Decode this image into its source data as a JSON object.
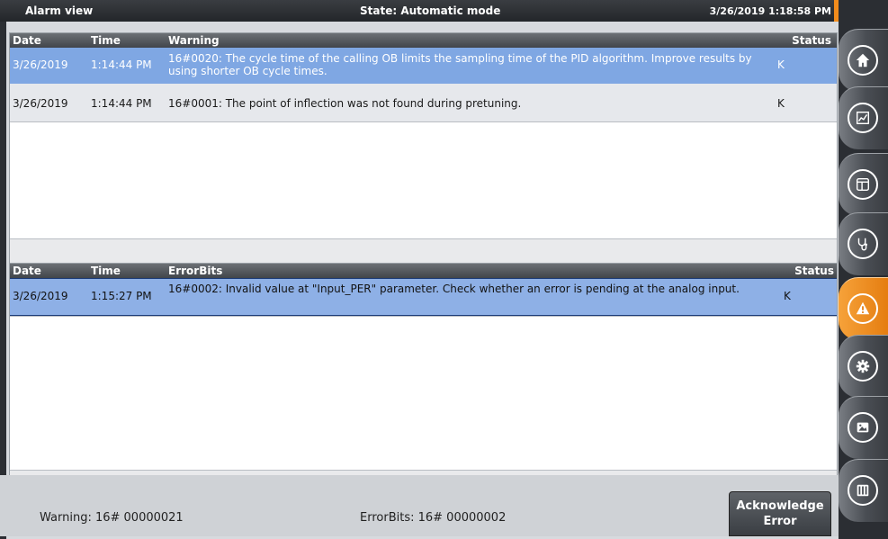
{
  "header": {
    "title": "Alarm view",
    "state": "State: Automatic mode",
    "datetime": "3/26/2019 1:18:58 PM"
  },
  "warnings": {
    "columns": {
      "date": "Date",
      "time": "Time",
      "message": "Warning",
      "status": "Status"
    },
    "rows": [
      {
        "date": "3/26/2019",
        "time": "1:14:44 PM",
        "message": "16#0020: The cycle time of the calling OB limits the sampling time of the PID algorithm. Improve results by using shorter OB cycle times.",
        "status": "K"
      },
      {
        "date": "3/26/2019",
        "time": "1:14:44 PM",
        "message": "16#0001: The point of inflection was not found during pretuning.",
        "status": "K"
      }
    ]
  },
  "errors": {
    "columns": {
      "date": "Date",
      "time": "Time",
      "message": "ErrorBits",
      "status": "Status"
    },
    "rows": [
      {
        "date": "3/26/2019",
        "time": "1:15:27 PM",
        "message": "16#0002: Invalid value at \"Input_PER\" parameter. Check whether an error is pending at the analog input.",
        "status": "K"
      }
    ]
  },
  "statusbar": {
    "warning": "Warning: 16# 00000021",
    "errorbits": "ErrorBits: 16# 00000002",
    "acknowledge_line1": "Acknowledge",
    "acknowledge_line2": "Error"
  },
  "nav": {
    "icons": [
      "home-icon",
      "trend-icon",
      "layout-icon",
      "stethoscope-icon",
      "alarm-icon",
      "gear-icon",
      "image-icon",
      "keypad-icon"
    ],
    "active": "alarm-icon",
    "accent_color": "#f28c1c"
  }
}
